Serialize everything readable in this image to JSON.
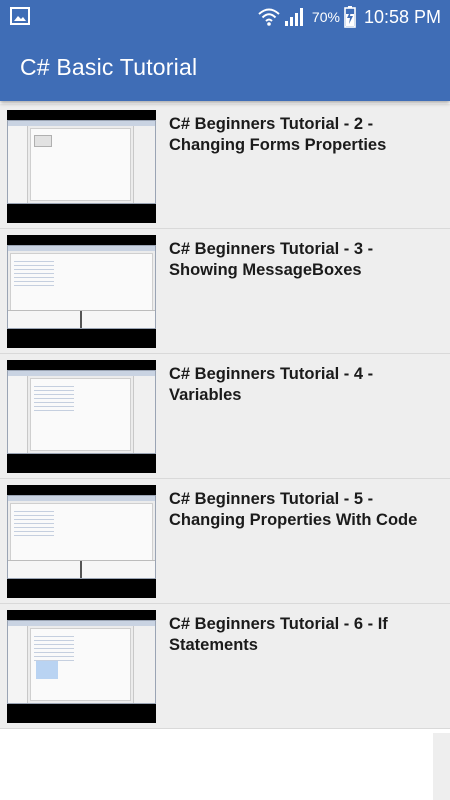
{
  "status_bar": {
    "battery_percent": "70%",
    "time": "10:58 PM",
    "icons": [
      "gallery-icon",
      "wifi-icon",
      "signal-icon",
      "battery-charging-icon"
    ]
  },
  "app_bar": {
    "title": "C# Basic Tutorial",
    "color": "#3f6db6"
  },
  "videos": [
    {
      "title": "C# Beginners Tutorial - 2 - Changing Forms Properties",
      "thumb_style": "form"
    },
    {
      "title": "C# Beginners Tutorial - 3 - Showing MessageBoxes",
      "thumb_style": "code-panel"
    },
    {
      "title": "C# Beginners Tutorial - 4 - Variables",
      "thumb_style": "code"
    },
    {
      "title": "C# Beginners Tutorial - 5 - Changing Properties With Code",
      "thumb_style": "code-panel"
    },
    {
      "title": "C# Beginners Tutorial - 6 - If Statements",
      "thumb_style": "highlight"
    }
  ]
}
